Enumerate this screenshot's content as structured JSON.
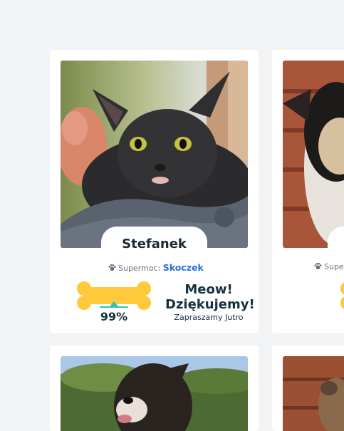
{
  "cards": [
    {
      "name": "Stefanek",
      "power_label": "Supermoc:",
      "power_value": "Skoczek",
      "progress_percent_text": "99%",
      "progress_value": 0.99,
      "headline_line1": "Meow!",
      "headline_line2": "Dziękujemy!",
      "subline": "Zapraszamy Jutro"
    },
    {
      "power_label": "Supe"
    }
  ],
  "colors": {
    "page_bg": "#f2f3f5",
    "bone": "#ffc93c",
    "progress": "#2ec4b6",
    "power_highlight": "#2b6fe0",
    "heading": "#15313f"
  },
  "icons": [
    "paw-icon",
    "bone-icon"
  ]
}
